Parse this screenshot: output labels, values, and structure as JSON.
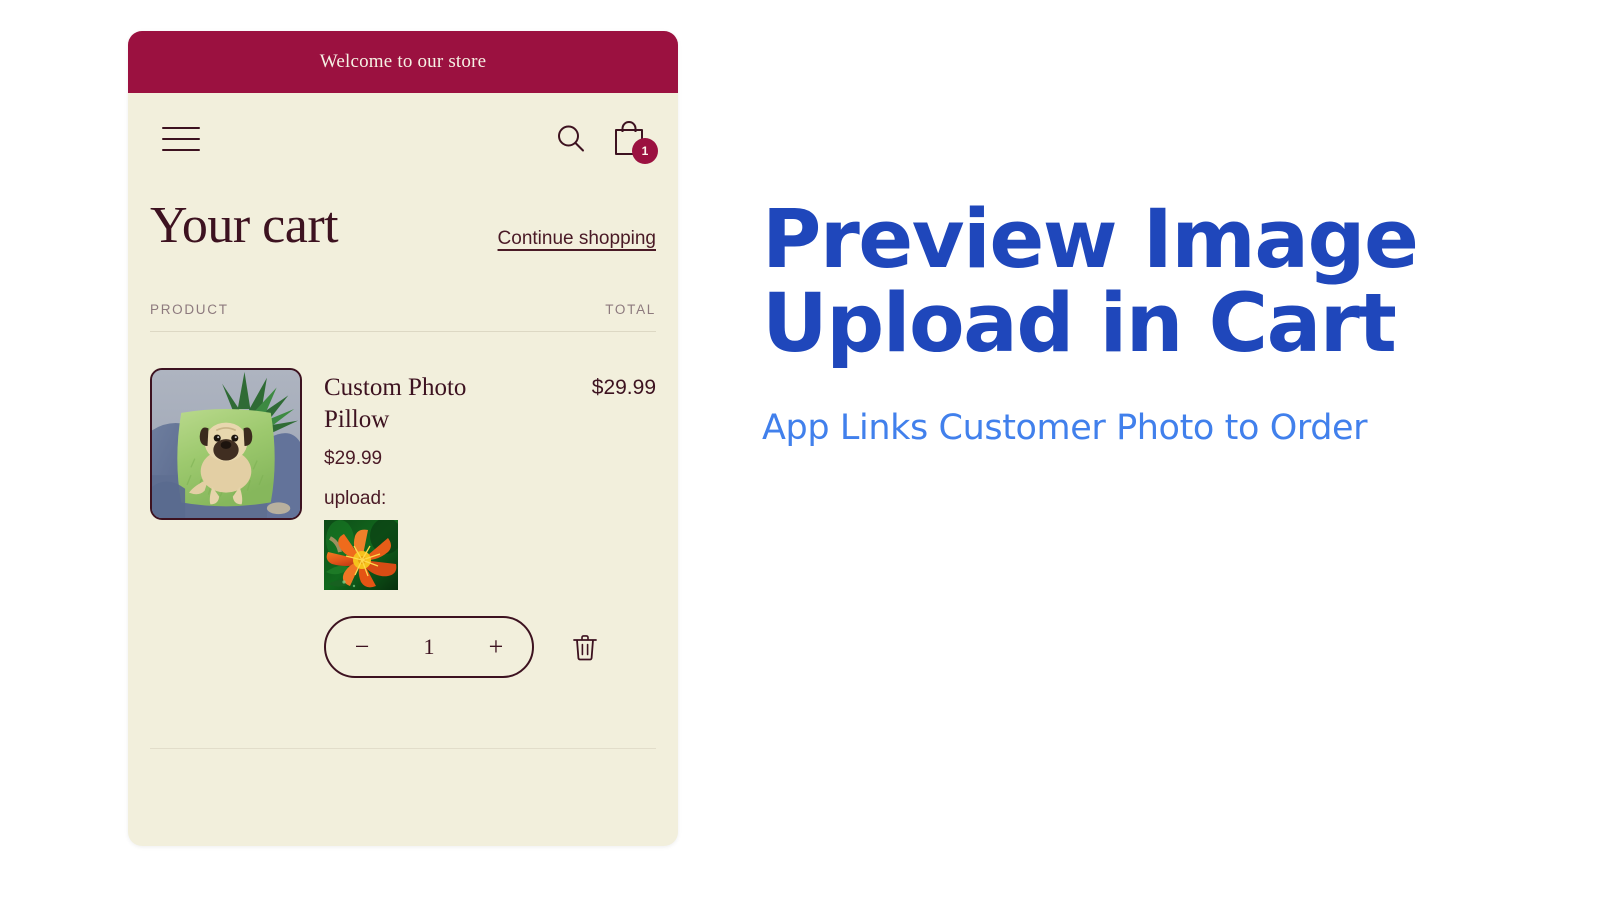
{
  "page": {
    "background_color": "#ffffff"
  },
  "storefront": {
    "announcement": {
      "text": "Welcome to our store",
      "background_color": "#9b1140",
      "text_color": "#f6f1e4"
    },
    "header": {
      "menu_icon": "hamburger-menu-icon",
      "search_icon": "search-icon",
      "cart_icon": "shopping-bag-icon",
      "cart_count": "1"
    },
    "cart": {
      "title": "Your cart",
      "continue_shopping": "Continue shopping",
      "columns": {
        "product": "PRODUCT",
        "total": "TOTAL"
      },
      "items": [
        {
          "name": "Custom Photo Pillow",
          "unit_price": "$29.99",
          "line_total": "$29.99",
          "upload_label": "upload:",
          "product_image_alt": "pug-on-green-pillow-photo",
          "uploaded_image_alt": "orange-daylily-flower-photo",
          "quantity": "1",
          "decrease_label": "−",
          "increase_label": "+",
          "remove_icon": "trash-icon"
        }
      ]
    },
    "theme": {
      "surface": "#f2efdc",
      "ink": "#3d1220",
      "muted": "#8d7a7e",
      "accent": "#9b1140"
    }
  },
  "promo": {
    "title_line_1": "Preview Image",
    "title_line_2": "Upload in Cart",
    "subtitle": "App Links Customer Photo to Order",
    "title_color": "#1f47bb",
    "subtitle_color": "#4180ec"
  }
}
